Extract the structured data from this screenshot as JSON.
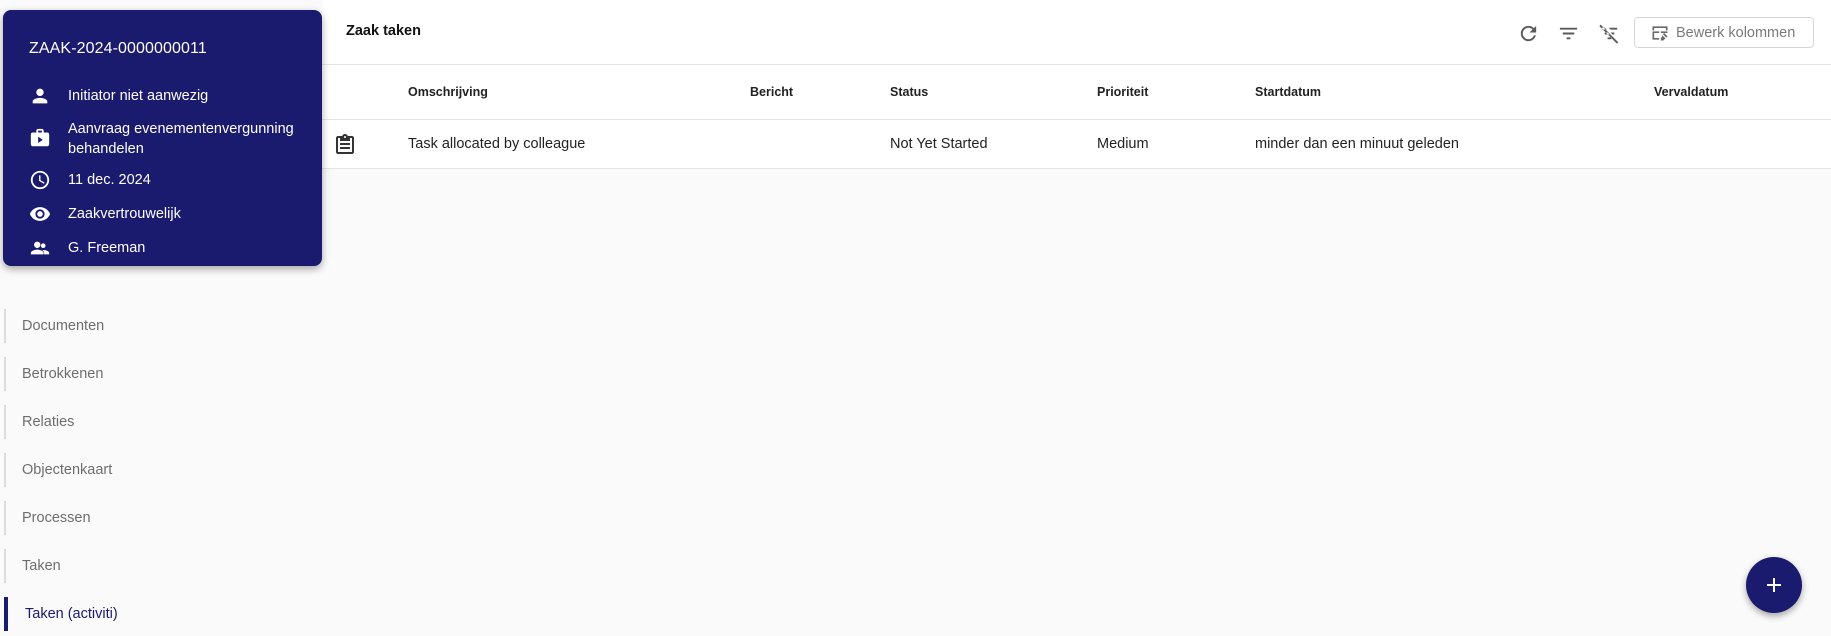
{
  "case": {
    "id": "ZAAK-2024-0000000011",
    "initiator": "Initiator niet aanwezig",
    "type": "Aanvraag evenementenvergunning behandelen",
    "date": "11 dec. 2024",
    "confidentiality": "Zaakvertrouwelijk",
    "assignee": "G. Freeman"
  },
  "panel": {
    "title": "Zaak taken",
    "edit_columns_label": "Bewerk kolommen",
    "icons": [
      "refresh-icon",
      "filter-icon",
      "filter-off-icon",
      "edit-columns-icon"
    ]
  },
  "table": {
    "headers": {
      "description": "Omschrijving",
      "message": "Bericht",
      "status": "Status",
      "priority": "Prioriteit",
      "start_date": "Startdatum",
      "due_date": "Vervaldatum"
    },
    "rows": [
      {
        "icon": "clipboard-icon",
        "description": "Task allocated by colleague",
        "message": "",
        "status": "Not Yet Started",
        "priority": "Medium",
        "start_date": "minder dan een minuut geleden",
        "due_date": ""
      }
    ]
  },
  "nav": {
    "items": [
      {
        "label": "Documenten"
      },
      {
        "label": "Betrokkenen"
      },
      {
        "label": "Relaties"
      },
      {
        "label": "Objectenkaart"
      },
      {
        "label": "Processen"
      },
      {
        "label": "Taken"
      },
      {
        "label": "Taken (activiti)"
      }
    ],
    "active": "Taken (activiti)"
  },
  "fab": {
    "icon": "plus-icon"
  },
  "colors": {
    "primary": "#1a1a6e",
    "background": "#fafafa"
  }
}
